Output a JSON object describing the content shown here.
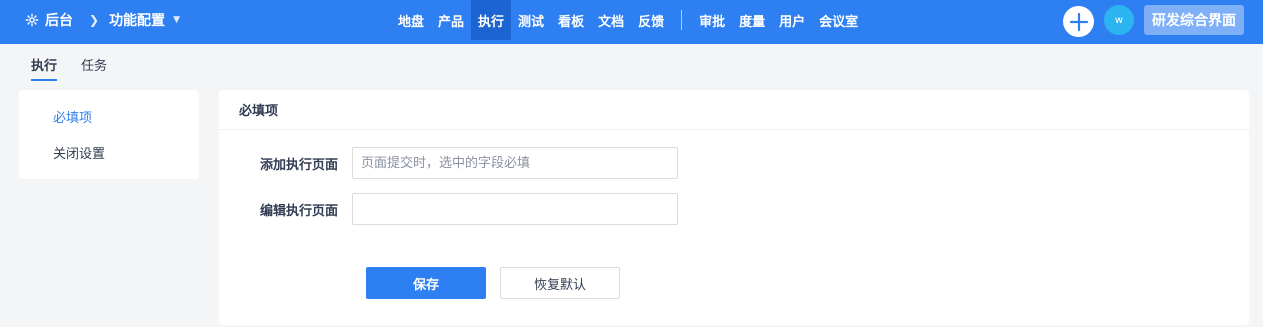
{
  "header": {
    "brand_label": "后台",
    "breadcrumb": "功能配置",
    "nav": [
      "地盘",
      "产品",
      "执行",
      "测试",
      "看板",
      "文档",
      "反馈"
    ],
    "nav_right": [
      "审批",
      "度量",
      "用户",
      "会议室"
    ],
    "active_nav": "执行",
    "avatar_initial": "w",
    "workspace_label": "研发综合界面",
    "accent_color": "#2e7ff1"
  },
  "subtabs": [
    {
      "label": "执行",
      "active": true
    },
    {
      "label": "任务",
      "active": false
    }
  ],
  "sidemenu": [
    {
      "label": "必填项",
      "active": true
    },
    {
      "label": "关闭设置",
      "active": false
    }
  ],
  "panel": {
    "title": "必填项",
    "fields": [
      {
        "label": "添加执行页面",
        "value": "",
        "placeholder": "页面提交时，选中的字段必填"
      },
      {
        "label": "编辑执行页面",
        "value": "",
        "placeholder": ""
      }
    ],
    "save_label": "保存",
    "reset_label": "恢复默认"
  }
}
